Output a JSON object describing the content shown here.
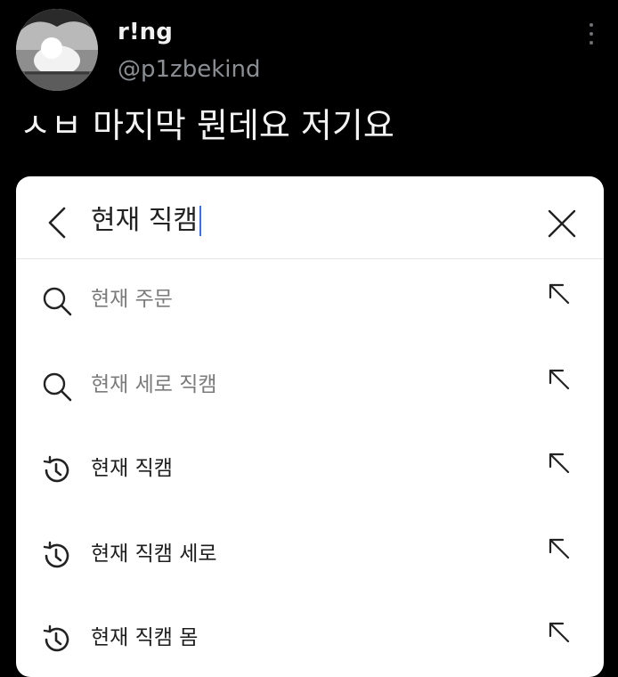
{
  "tweet": {
    "display_name": "r!ng",
    "handle": "@p1zbekind",
    "text": "ㅅㅂ 마지막 뭔데요 저기요"
  },
  "search": {
    "query": "현재 직캠",
    "suggestions": [
      {
        "type": "search",
        "icon": "search-icon",
        "label": "현재 주문"
      },
      {
        "type": "search",
        "icon": "search-icon",
        "label": "현재 세로 직캠"
      },
      {
        "type": "recent",
        "icon": "history-icon",
        "label": "현재 직캠"
      },
      {
        "type": "recent",
        "icon": "history-icon",
        "label": "현재 직캠 세로"
      },
      {
        "type": "recent",
        "icon": "history-icon",
        "label": "현재 직캠 몸"
      }
    ]
  },
  "colors": {
    "background": "#000000",
    "card": "#ffffff",
    "caret": "#3b6ee8",
    "muted_text": "#7b7b7b"
  }
}
